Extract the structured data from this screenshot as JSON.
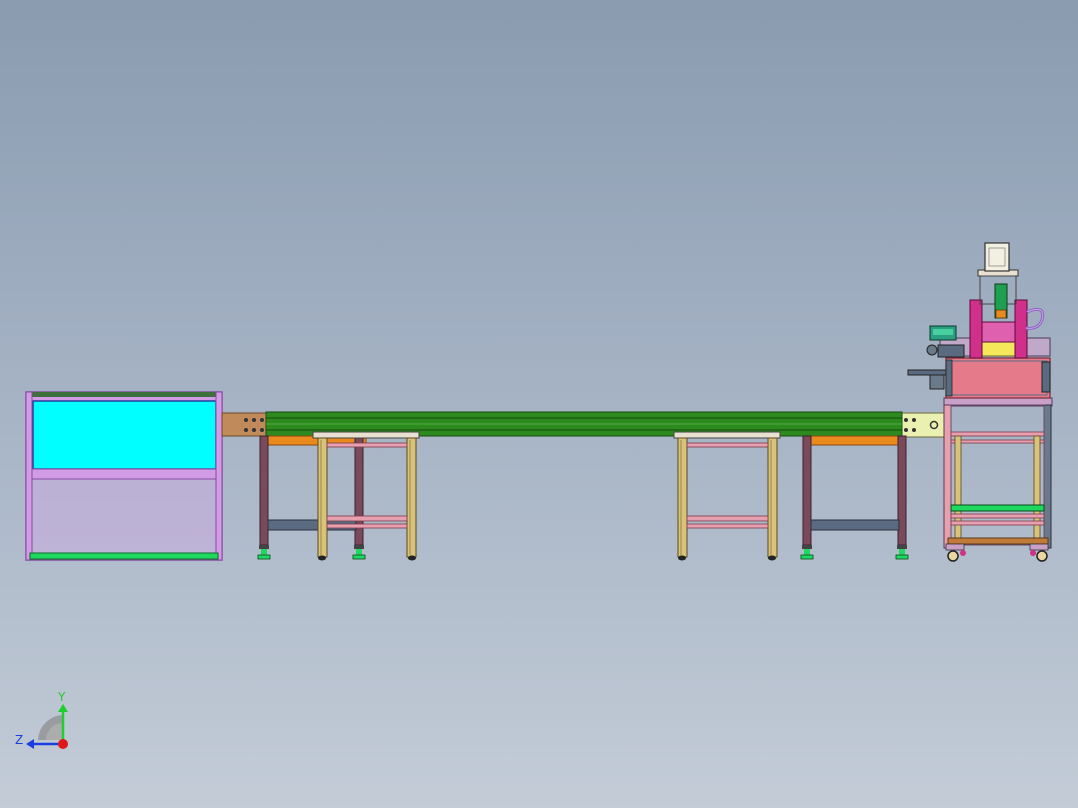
{
  "viewport": {
    "background_top": "#8a9bb0",
    "background_bottom": "#c3ccd7"
  },
  "triad": {
    "y_label": "Y",
    "z_label": "Z",
    "colors": {
      "y": "#1fcf2a",
      "z": "#1a3fe0",
      "x": "#e01818"
    }
  },
  "colors": {
    "frame_violet": "#d29be6",
    "screen_cyan": "#00ffff",
    "base_green": "#1ed860",
    "conveyor_green": "#2d8a1e",
    "conveyor_dark": "#1f5e12",
    "end_plate_tan": "#c08a5a",
    "end_plate_yellow": "#eaf0b0",
    "leg_brown": "#7a4a5a",
    "rail_orange": "#e98a1e",
    "stand_gold": "#d9c27a",
    "machine_pink": "#e57a8a",
    "machine_magenta": "#d0308a"
  }
}
